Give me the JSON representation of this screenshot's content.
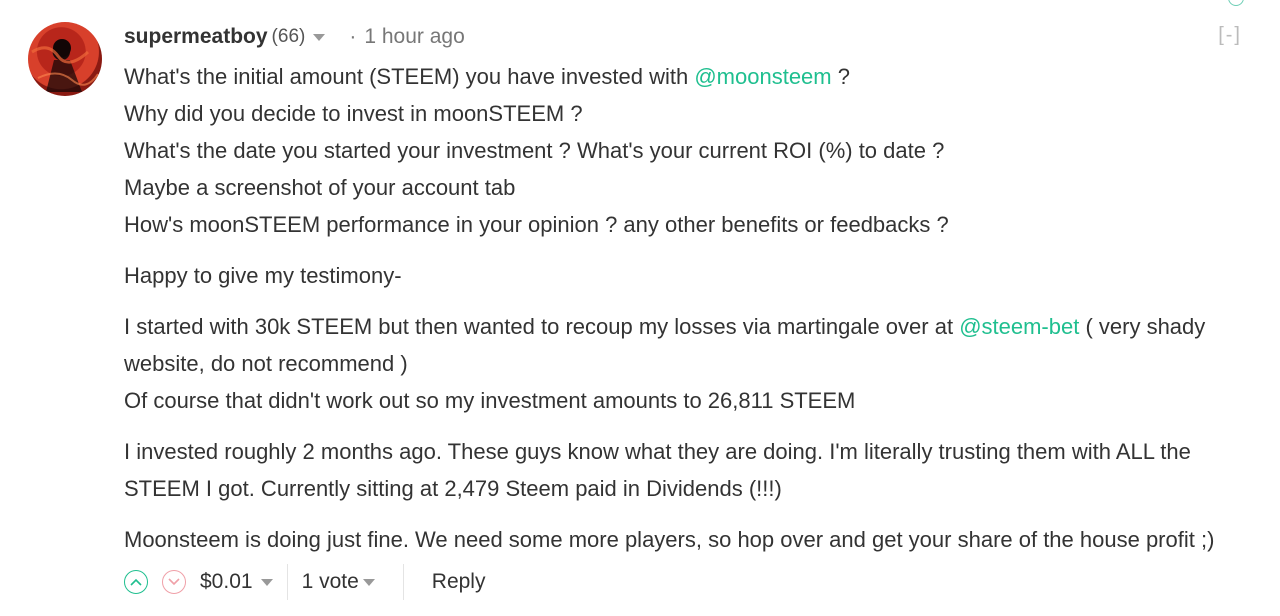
{
  "comment": {
    "author": "supermeatboy",
    "reputation": "(66)",
    "separator": "·",
    "timestamp": "1 hour ago",
    "collapse_label": "[-]",
    "body": {
      "questions": [
        {
          "before": "What's the initial amount (STEEM) you have invested with ",
          "mention": "@moonsteem",
          "after": " ?"
        },
        {
          "text": "Why did you decide to invest in moonSTEEM ?"
        },
        {
          "text": "What's the date you started your investment ? What's your current ROI (%) to date ?"
        },
        {
          "text": "Maybe a screenshot of your account tab"
        },
        {
          "text": "How's moonSTEEM performance in your opinion ? any other benefits or feedbacks ?"
        }
      ],
      "testimony_intro": "Happy to give my testimony-",
      "start_paragraph": {
        "before": "I started with 30k STEEM but then wanted to recoup my losses via martingale over at ",
        "mention": "@steem-bet",
        "after": " ( very shady website, do not recommend )"
      },
      "investment_line": "Of course that didn't work out so my investment amounts to 26,811 STEEM",
      "invested_paragraph": "I invested roughly 2 months ago. These guys know what they are doing. I'm literally trusting them with ALL the STEEM I got. Currently sitting at 2,479 Steem paid in Dividends (!!!)",
      "closing_paragraph": "Moonsteem is doing just fine. We need some more players, so hop over and get your share of the house profit ;)"
    },
    "footer": {
      "payout": "$0.01",
      "votes": "1 vote",
      "reply_label": "Reply"
    }
  },
  "colors": {
    "mention": "#1fbf8f",
    "upvote": "#1fbf8f",
    "downvote": "#f0a0a8"
  },
  "icons": {
    "upvote": "chevron-up-circle-icon",
    "downvote": "chevron-down-circle-icon",
    "dropdown": "caret-down-icon"
  }
}
